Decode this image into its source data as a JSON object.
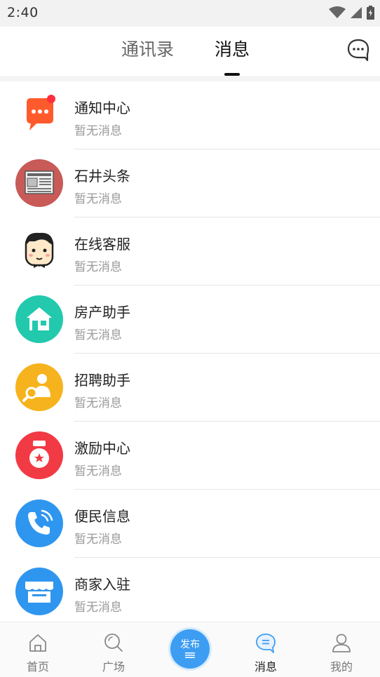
{
  "status_bar": {
    "time": "2:40"
  },
  "top_nav": {
    "tabs": [
      {
        "label": "通讯录",
        "active": false
      },
      {
        "label": "消息",
        "active": true
      }
    ]
  },
  "messages": [
    {
      "title": "通知中心",
      "subtitle": "暂无消息",
      "icon": "notification-bubble-icon",
      "color": "#ff5a2c",
      "badge": true
    },
    {
      "title": "石井头条",
      "subtitle": "暂无消息",
      "icon": "newspaper-icon",
      "color": "#c85a57"
    },
    {
      "title": "在线客服",
      "subtitle": "暂无消息",
      "icon": "customer-service-avatar-icon",
      "color": "#ffe9c9"
    },
    {
      "title": "房产助手",
      "subtitle": "暂无消息",
      "icon": "house-icon",
      "color": "#22c9ad"
    },
    {
      "title": "招聘助手",
      "subtitle": "暂无消息",
      "icon": "recruit-search-icon",
      "color": "#f6b31d"
    },
    {
      "title": "激励中心",
      "subtitle": "暂无消息",
      "icon": "medal-icon",
      "color": "#f23a45"
    },
    {
      "title": "便民信息",
      "subtitle": "暂无消息",
      "icon": "phone-icon",
      "color": "#2f96ef"
    },
    {
      "title": "商家入驻",
      "subtitle": "暂无消息",
      "icon": "storefront-icon",
      "color": "#2f96ef"
    }
  ],
  "bottom_nav": {
    "home": "首页",
    "plaza": "广场",
    "publish": "发布",
    "messages": "消息",
    "mine": "我的",
    "active": "消息",
    "accent_color": "#3d9df3"
  }
}
